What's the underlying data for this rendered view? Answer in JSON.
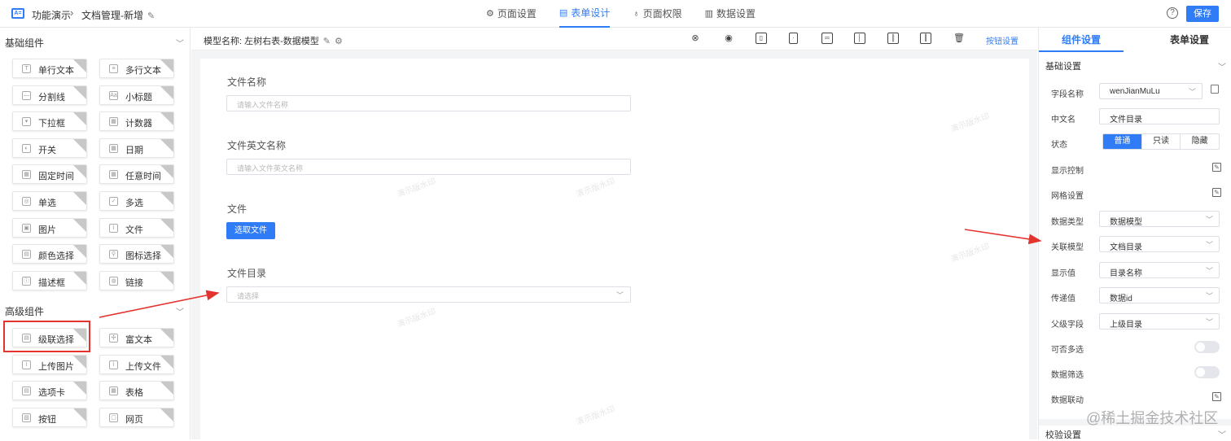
{
  "header": {
    "logo_text": "A=",
    "app_name": "功能演示",
    "breadcrumb_sep": "›",
    "page_name": "文档管理-新增",
    "tabs": [
      {
        "label": "页面设置",
        "icon": "gear-icon"
      },
      {
        "label": "表单设计",
        "icon": "document-icon",
        "active": true
      },
      {
        "label": "页面权限",
        "icon": "lock-icon"
      },
      {
        "label": "数据设置",
        "icon": "bar-chart-icon"
      }
    ],
    "help": "?",
    "save_label": "保存"
  },
  "left_panel": {
    "basic_title": "基础组件",
    "basic_components": [
      "单行文本",
      "多行文本",
      "分割线",
      "小标题",
      "下拉框",
      "计数器",
      "开关",
      "日期",
      "固定时间",
      "任意时间",
      "单选",
      "多选",
      "图片",
      "文件",
      "颜色选择",
      "图标选择",
      "描述框",
      "链接"
    ],
    "advanced_title": "高级组件",
    "advanced_components": [
      "级联选择",
      "富文本",
      "上传图片",
      "上传文件",
      "选项卡",
      "表格",
      "按钮",
      "网页"
    ]
  },
  "canvas": {
    "model_label": "模型名称:",
    "model_value": "左树右表-数据模型",
    "button_settings": "按钮设置",
    "watermark": "演示版水印",
    "fields": [
      {
        "label": "文件名称",
        "placeholder": "请输入文件名称"
      },
      {
        "label": "文件英文名称",
        "placeholder": "请输入文件英文名称"
      },
      {
        "label": "文件",
        "button": "选取文件"
      },
      {
        "label": "文件目录",
        "placeholder": "请选择"
      }
    ]
  },
  "right_panel": {
    "tab_component": "组件设置",
    "tab_form": "表单设置",
    "basic_section": "基础设置",
    "rows": {
      "field_name": {
        "label": "字段名称",
        "value": "wenJianMuLu"
      },
      "cn_name": {
        "label": "中文名",
        "value": "文件目录"
      },
      "status": {
        "label": "状态",
        "options": [
          "普通",
          "只读",
          "隐藏"
        ],
        "selected": "普通"
      },
      "display_ctrl": {
        "label": "显示控制"
      },
      "grid": {
        "label": "网格设置"
      },
      "data_type": {
        "label": "数据类型",
        "value": "数据模型"
      },
      "rel_model": {
        "label": "关联模型",
        "value": "文档目录"
      },
      "display_value": {
        "label": "显示值",
        "value": "目录名称"
      },
      "pass_value": {
        "label": "传递值",
        "value": "数据id"
      },
      "parent_field": {
        "label": "父级字段",
        "value": "上级目录"
      },
      "multi": {
        "label": "可否多选",
        "on": false
      },
      "filter": {
        "label": "数据筛选",
        "on": false
      },
      "linkage": {
        "label": "数据联动"
      }
    },
    "validate_section": "校验设置"
  },
  "watermark_text": "@稀土掘金技术社区",
  "colors": {
    "accent": "#2f7cf6",
    "annotation": "#e3342f"
  }
}
